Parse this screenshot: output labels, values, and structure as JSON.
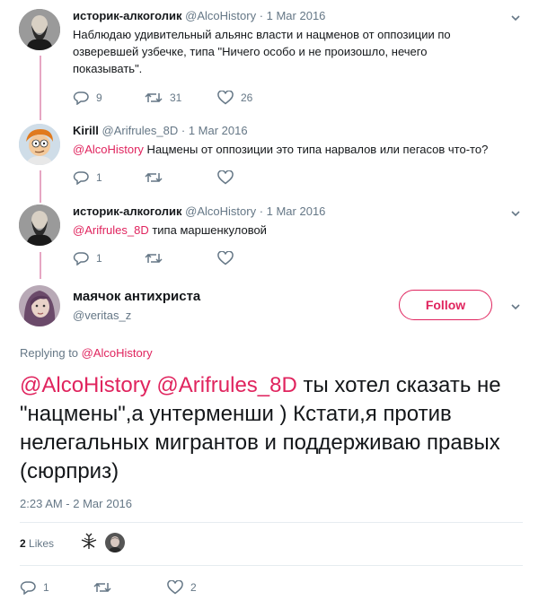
{
  "tweets": [
    {
      "name": "историк-алкоголик",
      "handle": "@AlcoHistory",
      "dot": " · ",
      "date": "1 Мar 2016",
      "text": "Наблюдаю удивительный альянс власти и нацменов от оппозиции по озверевшей узбечке, типа \"Ничего особо и не произошло, нечего показывать\".",
      "replies": "9",
      "retweets": "31",
      "likes": "26"
    },
    {
      "name": "Kirill",
      "handle": "@Arifrules_8D",
      "dot": " · ",
      "date": "1 Mar 2016",
      "mention": "@AlcoHistory",
      "text": " Нацмены от оппозиции это типа нарвалов или пегасов что-то?",
      "replies": "1",
      "retweets": "",
      "likes": ""
    },
    {
      "name": "историк-алкоголик",
      "handle": "@AlcoHistory",
      "dot": " · ",
      "date": "1 Мar 2016",
      "mention": "@Arifrules_8D",
      "text": " типа маршенкуловой",
      "replies": "1",
      "retweets": "",
      "likes": ""
    }
  ],
  "main": {
    "name": "маячок антихриста",
    "handle": "@veritas_z",
    "follow_label": "Follow",
    "replying_prefix": "Replying to ",
    "replying_to": "@AlcoHistory",
    "mention1": "@AlcoHistory",
    "mention2": "@Arifrules_8D",
    "text": " ты хотел сказать не \"нацмены\",а унтерменши ) Кстати,я против нелегальных мигрантов и поддерживаю правых (сюрприз)",
    "timestamp": "2:23 AM - 2 Mar 2016",
    "likes_count": "2",
    "likes_label": "Likes",
    "replies": "1",
    "retweets": "",
    "likes": "2"
  },
  "colors": {
    "accent": "#e0245e",
    "thread_line": "#e6a6c3",
    "meta": "#657786"
  }
}
